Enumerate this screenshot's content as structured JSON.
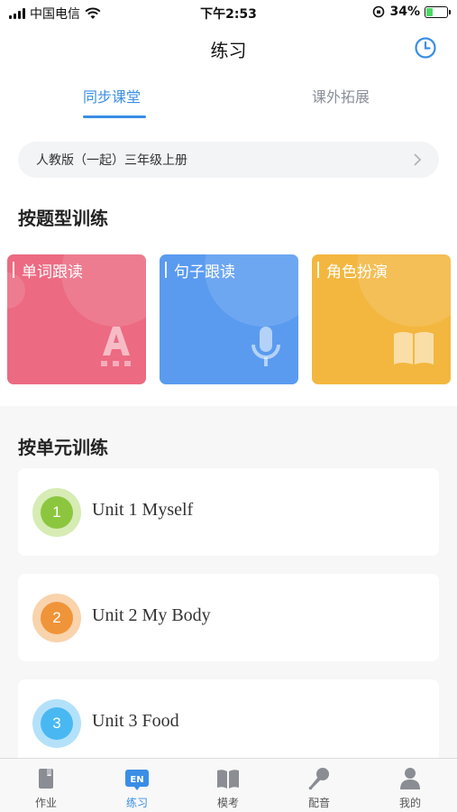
{
  "status_bar": {
    "carrier": "中国电信",
    "time": "下午2:53",
    "battery": "34%",
    "battery_level": 0.34
  },
  "nav": {
    "title": "练习",
    "history_icon": "clock-icon"
  },
  "tabs": [
    {
      "label": "同步课堂",
      "active": true
    },
    {
      "label": "课外拓展",
      "active": false
    }
  ],
  "textbook": {
    "label": "人教版（一起）三年级上册"
  },
  "by_type": {
    "title": "按题型训练",
    "cards": [
      {
        "label": "单词跟读",
        "color": "#ec6a82",
        "icon": "letter-a-icon"
      },
      {
        "label": "句子跟读",
        "color": "#5a9bf0",
        "icon": "microphone-icon"
      },
      {
        "label": "角色扮演",
        "color": "#f3b73f",
        "icon": "book-icon"
      }
    ]
  },
  "by_unit": {
    "title": "按单元训练",
    "units": [
      {
        "num": "1",
        "name": "Unit 1 Myself",
        "color": "#8cc63f",
        "ring": "#d6ecb4"
      },
      {
        "num": "2",
        "name": "Unit 2 My Body",
        "color": "#f0943a",
        "ring": "#f8d3ac"
      },
      {
        "num": "3",
        "name": "Unit 3 Food",
        "color": "#49b8f2",
        "ring": "#b4e1fa"
      }
    ]
  },
  "tabbar": [
    {
      "label": "作业",
      "icon": "homework-icon",
      "active": false
    },
    {
      "label": "练习",
      "icon": "practice-en-icon",
      "active": true,
      "badge": "EN"
    },
    {
      "label": "模考",
      "icon": "exam-book-icon",
      "active": false
    },
    {
      "label": "配音",
      "icon": "dubbing-mic-icon",
      "active": false
    },
    {
      "label": "我的",
      "icon": "profile-icon",
      "active": false
    }
  ],
  "colors": {
    "accent": "#3a8ee6"
  }
}
